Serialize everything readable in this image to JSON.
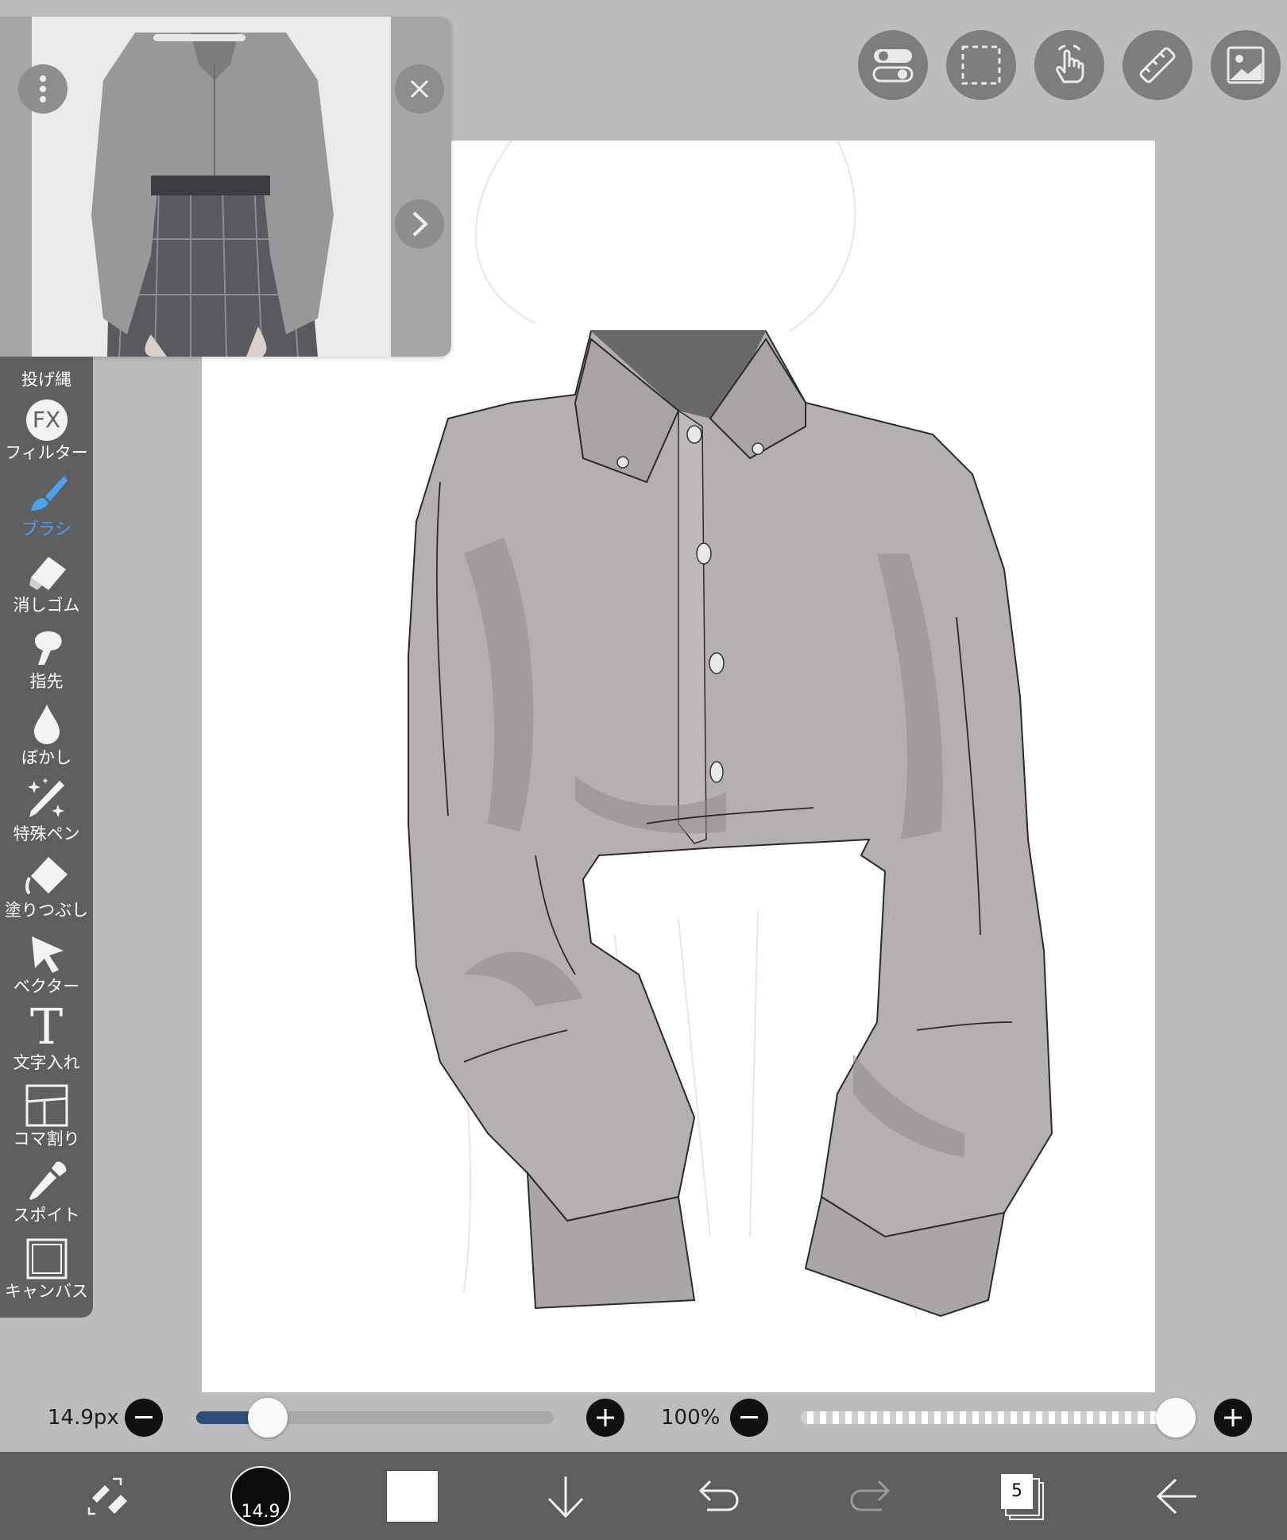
{
  "reference_window": {
    "menu_icon": "more-vertical-icon",
    "close_icon": "close-icon",
    "next_icon": "chevron-right-icon"
  },
  "top_toolbar": {
    "buttons": [
      {
        "icon": "toggle-switch-icon"
      },
      {
        "icon": "selection-icon"
      },
      {
        "icon": "touch-gesture-icon"
      },
      {
        "icon": "ruler-icon"
      },
      {
        "icon": "image-icon"
      }
    ]
  },
  "left_toolbar": {
    "items": [
      {
        "label": "投げ縄",
        "icon": "lasso-icon"
      },
      {
        "label": "フィルター",
        "icon": "fx-filter-icon",
        "icon_text": "FX"
      },
      {
        "label": "ブラシ",
        "icon": "brush-icon",
        "active": true
      },
      {
        "label": "消しゴム",
        "icon": "eraser-icon"
      },
      {
        "label": "指先",
        "icon": "finger-smudge-icon"
      },
      {
        "label": "ぼかし",
        "icon": "blur-drop-icon"
      },
      {
        "label": "特殊ペン",
        "icon": "special-pen-icon"
      },
      {
        "label": "塗りつぶし",
        "icon": "fill-bucket-icon"
      },
      {
        "label": "ベクター",
        "icon": "vector-arrow-icon"
      },
      {
        "label": "文字入れ",
        "icon": "text-icon",
        "icon_text": "T"
      },
      {
        "label": "コマ割り",
        "icon": "panel-frame-icon"
      },
      {
        "label": "スポイト",
        "icon": "eyedropper-icon"
      },
      {
        "label": "キャンバス",
        "icon": "canvas-icon"
      }
    ]
  },
  "brush_controls": {
    "size_label": "14.9px",
    "size_fraction": 0.2,
    "opacity_label": "100%",
    "opacity_fraction": 1.0,
    "accent_color": "#2d4e78"
  },
  "bottom_bar": {
    "swap_icon": "swap-eraser-icon",
    "brush_size_value": "14.9",
    "color_swatch": "#ffffff",
    "download_icon": "arrow-down-icon",
    "undo_icon": "undo-icon",
    "redo_icon": "redo-icon",
    "layers_count": "5",
    "back_icon": "arrow-left-icon"
  }
}
